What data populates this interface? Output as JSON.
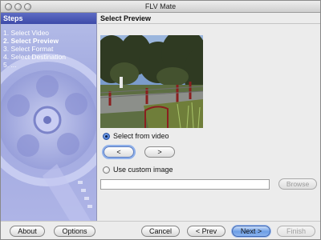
{
  "window": {
    "title": "FLV Mate"
  },
  "steps": {
    "header": "Steps",
    "items": [
      {
        "label": "1. Select Video",
        "active": false
      },
      {
        "label": "2. Select Preview",
        "active": true
      },
      {
        "label": "3. Select Format",
        "active": false
      },
      {
        "label": "4. Select Destination",
        "active": false
      },
      {
        "label": "5. ...",
        "active": false
      }
    ]
  },
  "content": {
    "header": "Select Preview",
    "select_from_video_label": "Select from video",
    "select_from_video_checked": true,
    "prev_frame_label": "<",
    "next_frame_label": ">",
    "use_custom_image_label": "Use custom image",
    "use_custom_image_checked": false,
    "custom_image_path": "",
    "browse_label": "Browse"
  },
  "footer": {
    "about_label": "About",
    "options_label": "Options",
    "cancel_label": "Cancel",
    "prev_label": "< Prev",
    "next_label": "Next >",
    "finish_label": "Finish"
  },
  "colors": {
    "steps_header": "#3d4aa8",
    "steps_panel": "#a3abe0",
    "default_button": "#6d9ee6"
  }
}
